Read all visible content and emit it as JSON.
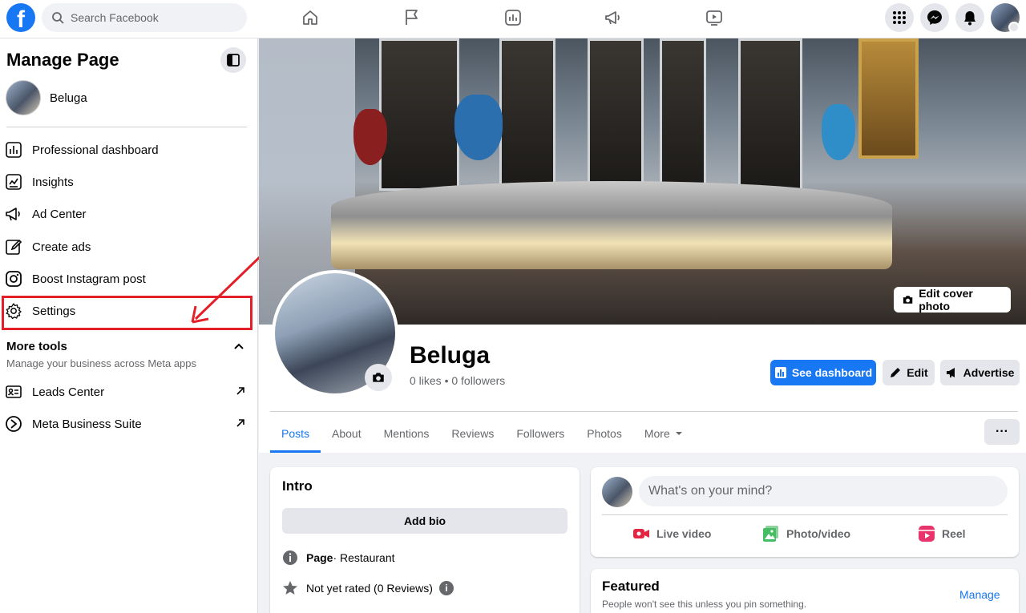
{
  "topbar": {
    "search_placeholder": "Search Facebook",
    "logo_letter": "f"
  },
  "sidebar": {
    "title": "Manage Page",
    "page_name": "Beluga",
    "items": [
      {
        "label": "Professional dashboard",
        "icon": "dashboard-icon"
      },
      {
        "label": "Insights",
        "icon": "insights-icon"
      },
      {
        "label": "Ad Center",
        "icon": "megaphone-icon"
      },
      {
        "label": "Create ads",
        "icon": "pencil-icon"
      },
      {
        "label": "Boost Instagram post",
        "icon": "instagram-icon"
      },
      {
        "label": "Settings",
        "icon": "gear-icon"
      }
    ],
    "more_tools": {
      "title": "More tools",
      "subtitle": "Manage your business across Meta apps",
      "items": [
        {
          "label": "Leads Center",
          "icon": "id-card-icon"
        },
        {
          "label": "Meta Business Suite",
          "icon": "meta-suite-icon"
        }
      ]
    }
  },
  "profile": {
    "edit_cover_label": "Edit cover photo",
    "name": "Beluga",
    "stats": "0 likes • 0 followers",
    "buttons": {
      "see_dashboard": "See dashboard",
      "edit": "Edit",
      "advertise": "Advertise"
    },
    "more_dots": "···"
  },
  "tabs": [
    {
      "label": "Posts",
      "active": true
    },
    {
      "label": "About"
    },
    {
      "label": "Mentions"
    },
    {
      "label": "Reviews"
    },
    {
      "label": "Followers"
    },
    {
      "label": "Photos"
    },
    {
      "label": "More"
    }
  ],
  "intro": {
    "title": "Intro",
    "add_bio": "Add bio",
    "category_label": "Page",
    "category_value": " · Restaurant",
    "rating": "Not yet rated (0 Reviews)",
    "info_glyph": "i"
  },
  "composer": {
    "placeholder": "What's on your mind?",
    "actions": {
      "live": "Live video",
      "photo": "Photo/video",
      "reel": "Reel"
    }
  },
  "featured": {
    "title": "Featured",
    "subtitle": "People won't see this unless you pin something.",
    "manage": "Manage"
  },
  "colors": {
    "brand": "#1877f2",
    "highlight": "#e3202a",
    "live": "#e42645",
    "photo": "#45bd62",
    "reel": "#e8336d"
  }
}
